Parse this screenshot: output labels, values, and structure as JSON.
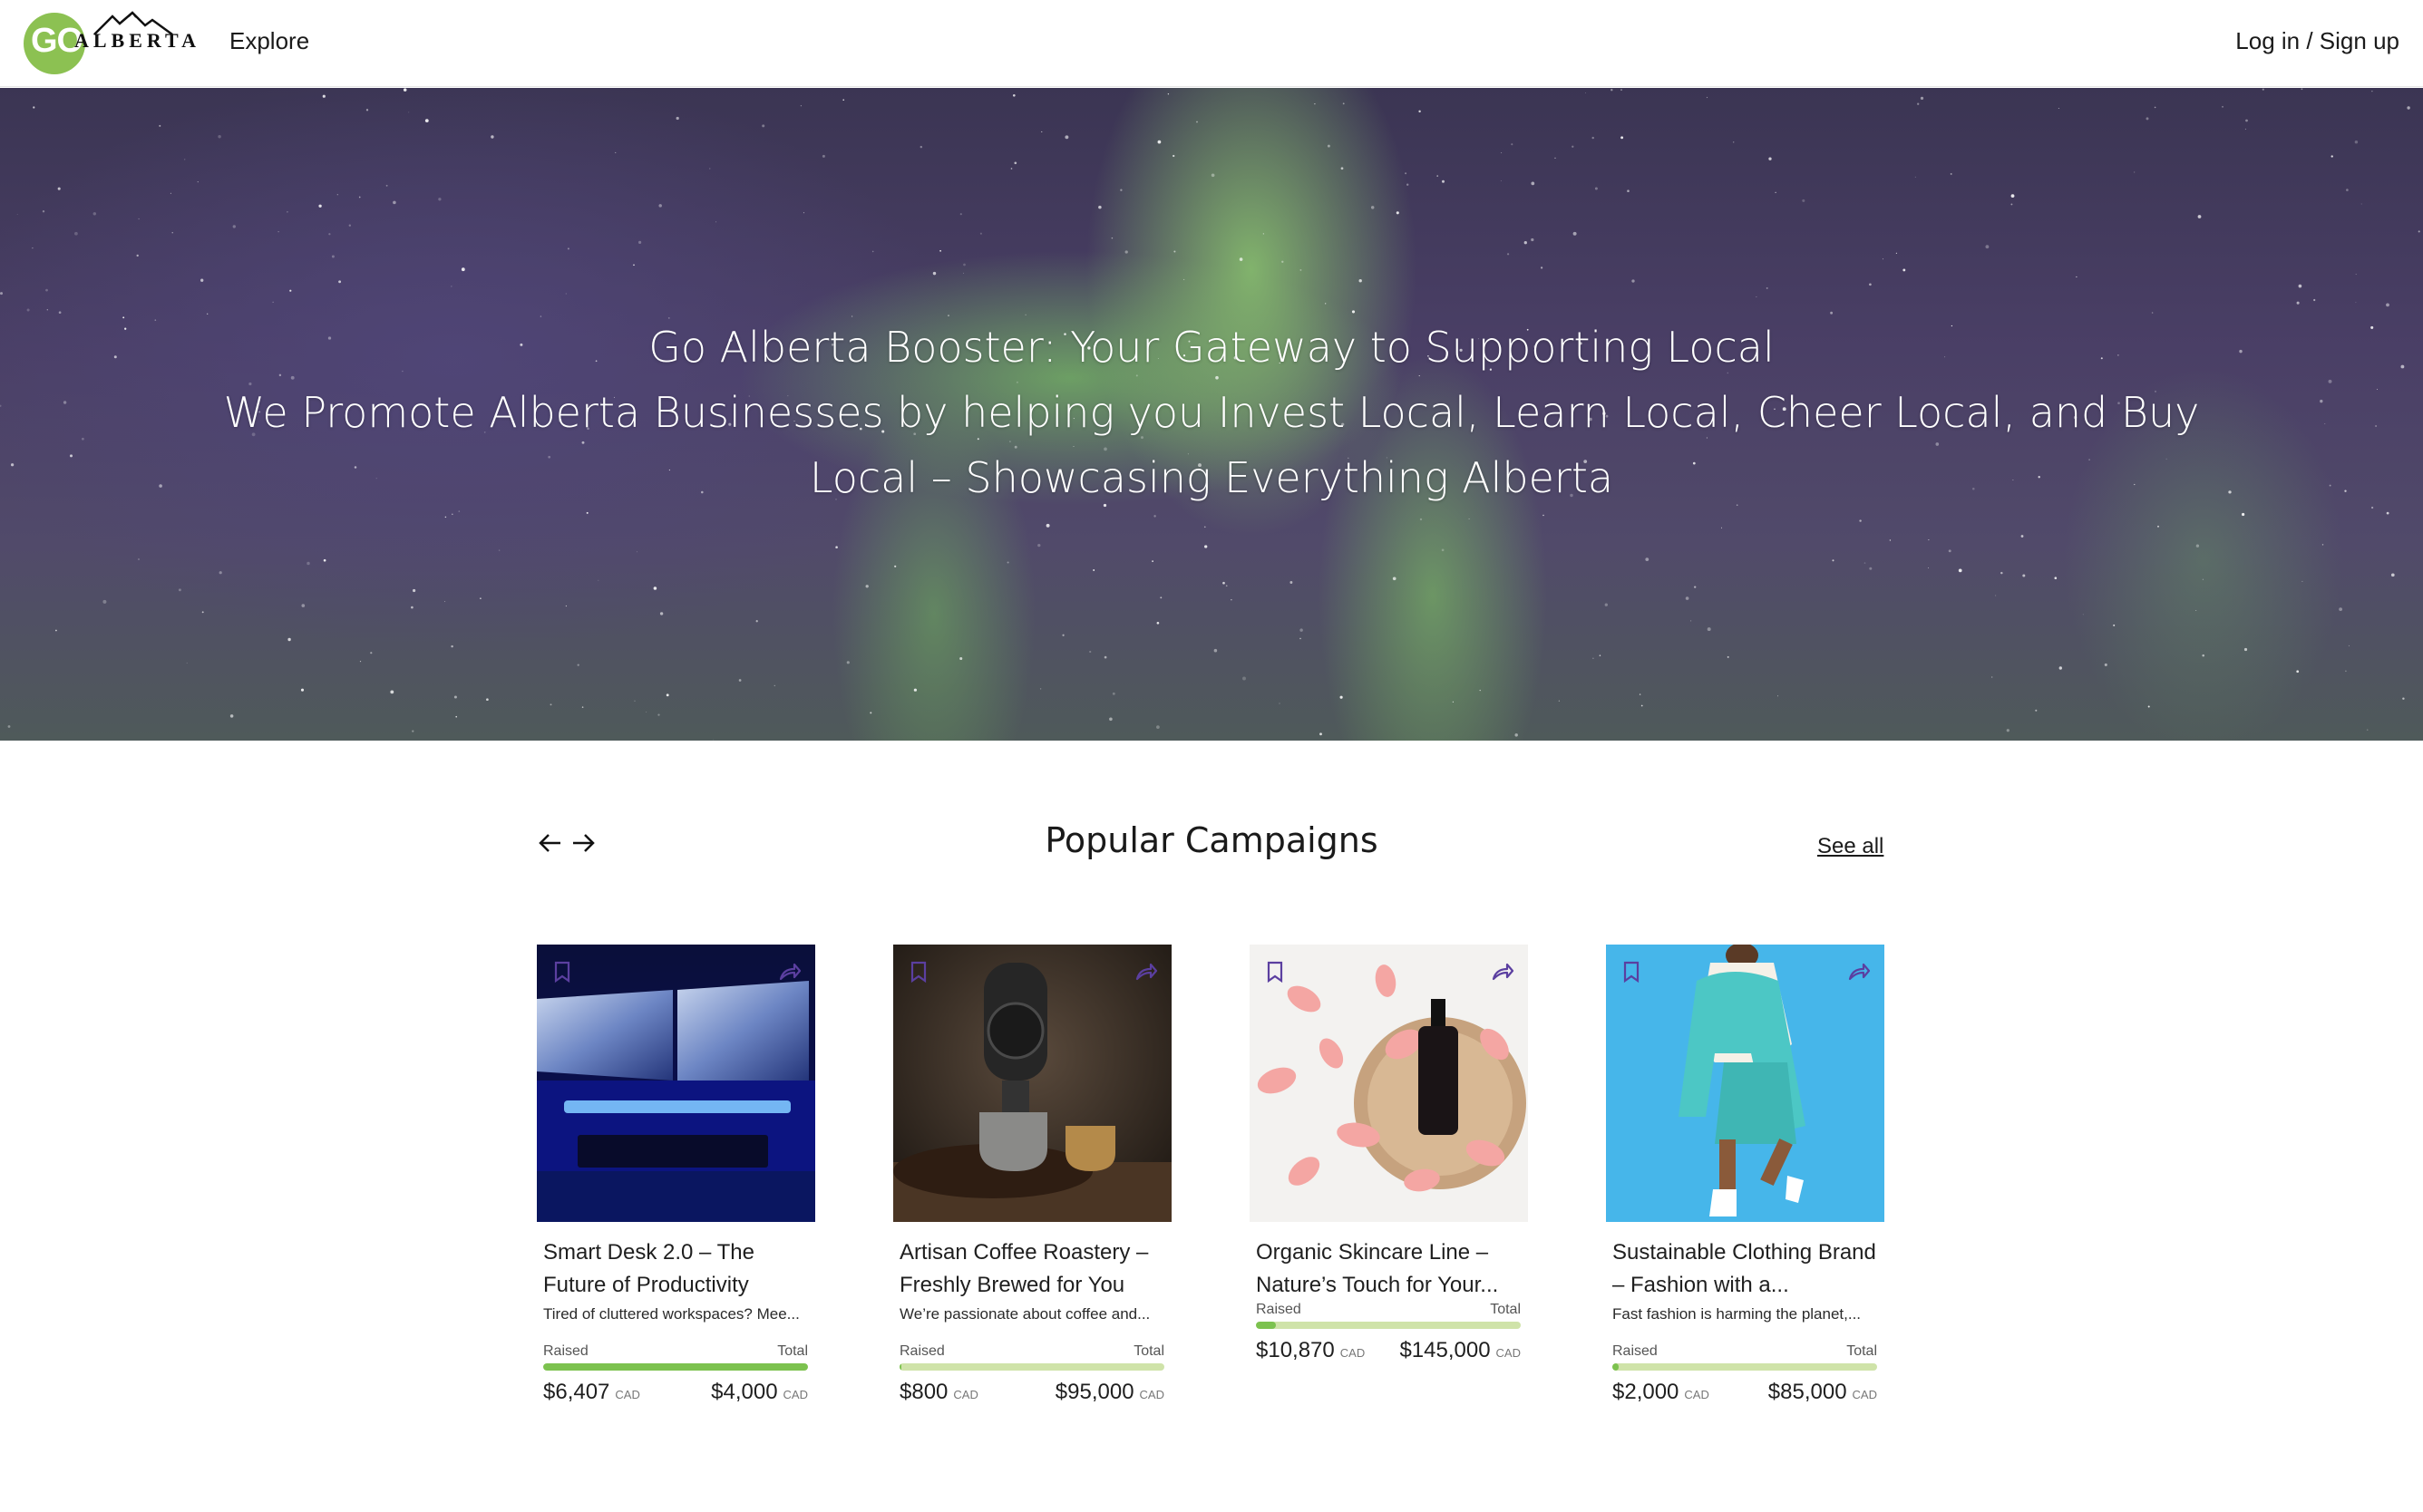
{
  "header": {
    "logo_text_go": "GO",
    "logo_text_alberta": "ALBERTA",
    "nav_explore": "Explore",
    "login": "Log in / Sign up"
  },
  "hero": {
    "line1": "Go Alberta Booster: Your Gateway to Supporting Local",
    "line2": "We Promote Alberta Businesses by helping you Invest Local, Learn Local, Cheer Local, and Buy",
    "line3": "Local – Showcasing Everything Alberta"
  },
  "section": {
    "title": "Popular Campaigns",
    "see_all": "See all",
    "prev_icon": "arrow-left-icon",
    "next_icon": "arrow-right-icon"
  },
  "campaigns": [
    {
      "title": "Smart Desk 2.0 – The Future of Productivity",
      "description": "Tired of cluttered workspaces? Mee...",
      "raised_label": "Raised",
      "total_label": "Total",
      "raised": "$6,407",
      "total": "$4,000",
      "currency": "CAD",
      "progress": 1.0,
      "image": "desk-monitors"
    },
    {
      "title": "Artisan Coffee Roastery – Freshly Brewed for You",
      "description": "We’re passionate about coffee and...",
      "raised_label": "Raised",
      "total_label": "Total",
      "raised": "$800",
      "total": "$95,000",
      "currency": "CAD",
      "progress": 0.008,
      "image": "coffee-cups"
    },
    {
      "title": "Organic Skincare Line – Nature’s Touch for Your...",
      "description": "",
      "raised_label": "Raised",
      "total_label": "Total",
      "raised": "$10,870",
      "total": "$145,000",
      "currency": "CAD",
      "progress": 0.075,
      "image": "rose-petals-bottle"
    },
    {
      "title": "Sustainable Clothing Brand – Fashion with a...",
      "description": "Fast fashion is harming the planet,...",
      "raised_label": "Raised",
      "total_label": "Total",
      "raised": "$2,000",
      "total": "$85,000",
      "currency": "CAD",
      "progress": 0.024,
      "image": "teal-outfit"
    }
  ],
  "colors": {
    "brand_green": "#8cc152",
    "progress_fill": "#7cc24f",
    "progress_track": "#cfe3a9",
    "card_icon": "#5b3fa0"
  },
  "icons": {
    "bookmark": "bookmark-icon",
    "share": "share-icon",
    "mountain": "mountain-logo-icon"
  }
}
